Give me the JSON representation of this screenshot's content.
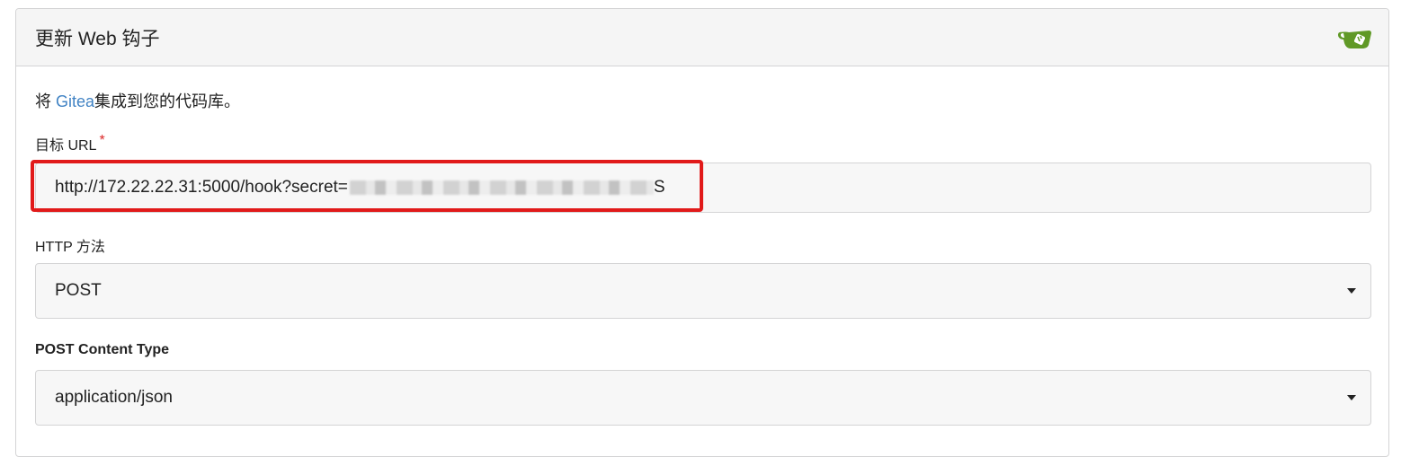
{
  "header": {
    "title": "更新 Web 钩子",
    "logo_icon": "gitea-logo-icon"
  },
  "description": {
    "prefix": "将 ",
    "link_text": "Gitea",
    "suffix": "集成到您的代码库。"
  },
  "target_url": {
    "label": "目标 URL",
    "required_mark": "*",
    "value_visible_start": "http://172.22.22.31:5000/hook?secret=",
    "value_visible_end": "S"
  },
  "http_method": {
    "label": "HTTP 方法",
    "selected": "POST"
  },
  "content_type": {
    "label": "POST Content Type",
    "selected": "application/json"
  },
  "colors": {
    "accent_link": "#4183c4",
    "highlight_border": "#e11a1a",
    "logo_green": "#609926"
  }
}
